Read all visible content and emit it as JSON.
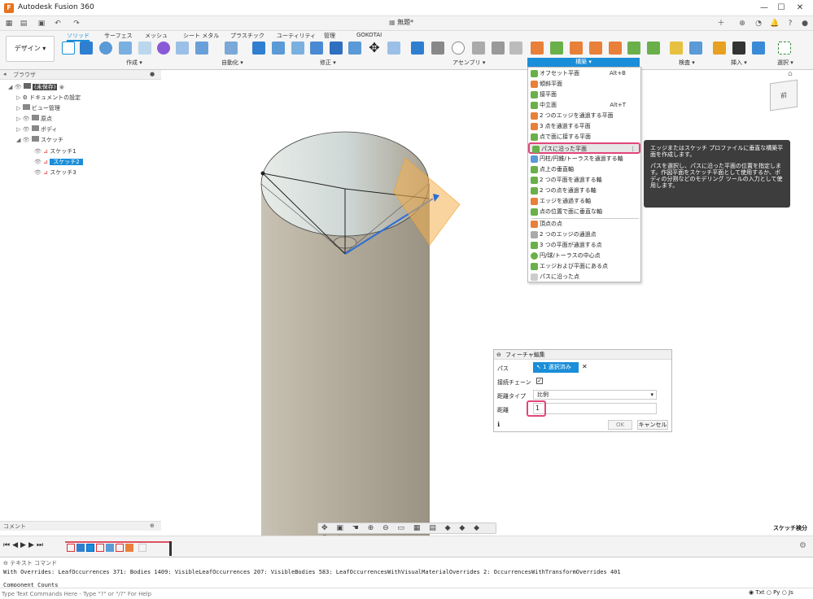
{
  "app_title": "Autodesk Fusion 360",
  "doc_tab": "無題*",
  "workspace": "デザイン ▾",
  "ribbon_tabs": [
    "ソリッド",
    "サーフェス",
    "メッシュ",
    "シート メタル",
    "プラスチック",
    "ユーティリティ",
    "管理",
    "GOKOTAI"
  ],
  "ribbon_groups": {
    "create": "作成 ▾",
    "automate": "自動化 ▾",
    "modify": "修正 ▾",
    "assemble": "アセンブリ ▾",
    "construct": "構築 ▾",
    "inspect": "検査 ▾",
    "insert": "挿入 ▾",
    "select": "選択 ▾"
  },
  "browser": {
    "title": "ブラウザ",
    "root": "(未保存)",
    "items": [
      "ドキュメントの設定",
      "ビュー管理",
      "原点",
      "ボディ",
      "スケッチ"
    ],
    "sketches": [
      "スケッチ1",
      "スケッチ2",
      "スケッチ3"
    ]
  },
  "construct_menu": {
    "items": [
      {
        "label": "オフセット平面",
        "shortcut": "Alt+B"
      },
      {
        "label": "傾斜平面",
        "shortcut": ""
      },
      {
        "label": "接平面",
        "shortcut": ""
      },
      {
        "label": "中立面",
        "shortcut": "Alt+T"
      },
      {
        "label": "2 つのエッジを通過する平面",
        "shortcut": ""
      },
      {
        "label": "3 点を通過する平面",
        "shortcut": ""
      },
      {
        "label": "点で面に接する平面",
        "shortcut": ""
      },
      {
        "label": "パスに沿った平面",
        "shortcut": ""
      },
      {
        "label": "円柱/円錐/トーラスを通過する軸",
        "shortcut": ""
      },
      {
        "label": "点上の垂直軸",
        "shortcut": ""
      },
      {
        "label": "2 つの平面を通過する軸",
        "shortcut": ""
      },
      {
        "label": "2 つの点を通過する軸",
        "shortcut": ""
      },
      {
        "label": "エッジを通過する軸",
        "shortcut": ""
      },
      {
        "label": "点の位置で面に垂直な軸",
        "shortcut": ""
      },
      {
        "label": "頂点の点",
        "shortcut": ""
      },
      {
        "label": "2 つのエッジの通過点",
        "shortcut": ""
      },
      {
        "label": "3 つの平面が通過する点",
        "shortcut": ""
      },
      {
        "label": "円/球/トーラスの中心点",
        "shortcut": ""
      },
      {
        "label": "エッジおよび平面にある点",
        "shortcut": ""
      },
      {
        "label": "パスに沿った点",
        "shortcut": ""
      }
    ]
  },
  "tooltip": {
    "line1": "エッジまたはスケッチ プロファイルに垂直な構築平面を作成します。",
    "line2": "パスを選択し、パスに沿った平面の位置を指定します。作図平面をスケッチ平面として使用するか、ボディの分割などのモデリング ツールの入力として使用します。"
  },
  "feature_dialog": {
    "title": "フィーチャ編集",
    "path_label": "パス",
    "path_value": "1 選択済み",
    "chain_label": "接続チェーン",
    "dist_type_label": "距離タイプ",
    "dist_type_value": "比例",
    "distance_label": "距離",
    "distance_value": "1",
    "ok": "OK",
    "cancel": "キャンセル"
  },
  "comment_label": "コメント",
  "sketch_palette": "スケッチ検分",
  "viewcube": "前",
  "text_commands": {
    "title": "テキスト コマンド",
    "output": "With Overrides: LeafOccurrences 371: Bodies 1409: VisibleLeafOccurrences 207: VisibleBodies 583: LeafOccurrencesWithVisualMaterialOverrides 2: OccurrencesWithTransformOverrides 401",
    "output2": "Component Counts",
    "placeholder": "Type Text Commands Here - Type \"?\" or \"/?\" For Help",
    "modes": [
      "Txt",
      "Py",
      "Js"
    ]
  }
}
